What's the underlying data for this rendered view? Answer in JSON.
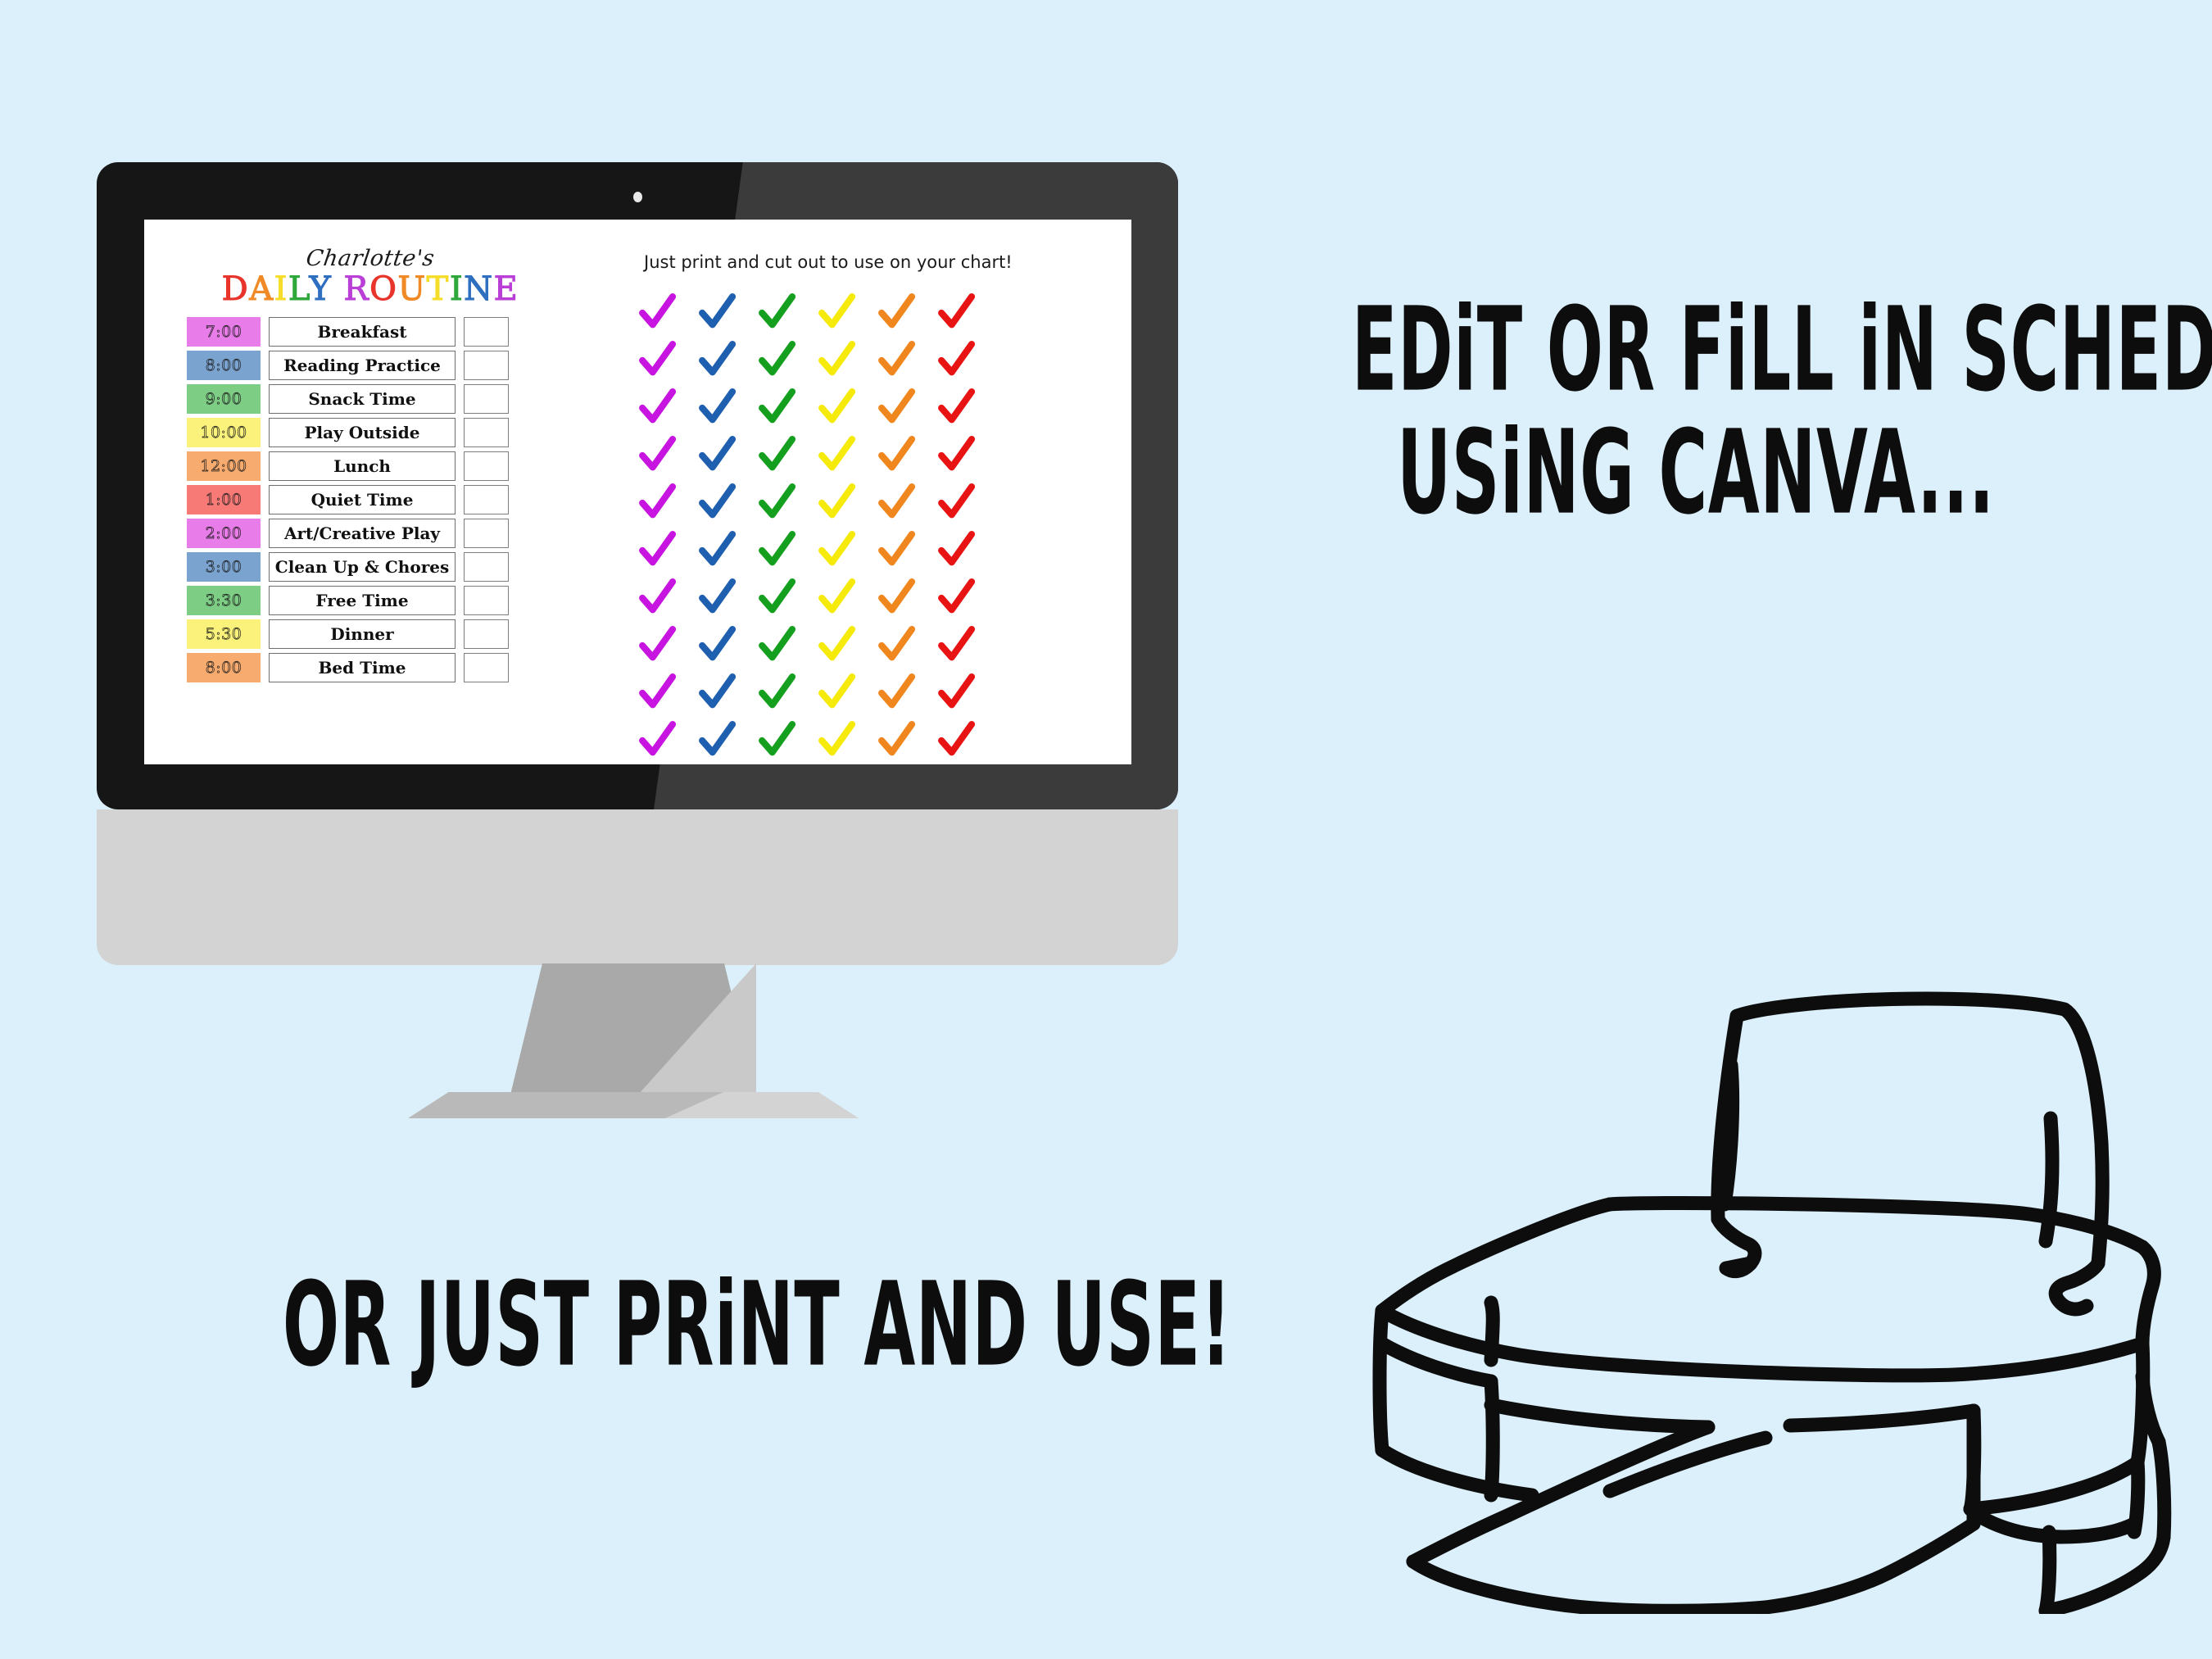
{
  "page": {
    "background_color": "#dcf0fb",
    "ink_color": "#0d0d0d"
  },
  "headline": {
    "line1": "EDiT OR FiLL iN SCHEDULE",
    "line2": "USiNG CANVA..."
  },
  "subline": {
    "text": "OR JUST PRiNT AND USE!"
  },
  "monitor": {
    "bezel_color": "#161616",
    "chin_color": "#d3d3d3",
    "stand_color": "#a9a9a9",
    "webcam": "webcam-dot"
  },
  "screen": {
    "owner_name": "Charlotte's",
    "title_letters": [
      {
        "char": "D",
        "color": "#e8342a"
      },
      {
        "char": "A",
        "color": "#f08a26"
      },
      {
        "char": "I",
        "color": "#f5dd2a"
      },
      {
        "char": "L",
        "color": "#2fa83b"
      },
      {
        "char": "Y",
        "color": "#2f6fc0"
      },
      {
        "char": " ",
        "color": "#000000"
      },
      {
        "char": "R",
        "color": "#b93fd6"
      },
      {
        "char": "O",
        "color": "#e8342a"
      },
      {
        "char": "U",
        "color": "#f08a26"
      },
      {
        "char": "T",
        "color": "#f5dd2a"
      },
      {
        "char": "I",
        "color": "#2fa83b"
      },
      {
        "char": "N",
        "color": "#2f6fc0"
      },
      {
        "char": "E",
        "color": "#b93fd6"
      }
    ],
    "title_text": "DAILY ROUTINE",
    "schedule": [
      {
        "time": "7:00",
        "activity": "Breakfast",
        "pill_color": "#e87ce8"
      },
      {
        "time": "8:00",
        "activity": "Reading Practice",
        "pill_color": "#7ba3d0"
      },
      {
        "time": "9:00",
        "activity": "Snack Time",
        "pill_color": "#7dcd85"
      },
      {
        "time": "10:00",
        "activity": "Play Outside",
        "pill_color": "#faf27a"
      },
      {
        "time": "12:00",
        "activity": "Lunch",
        "pill_color": "#f7ab6e"
      },
      {
        "time": "1:00",
        "activity": "Quiet Time",
        "pill_color": "#f77a77"
      },
      {
        "time": "2:00",
        "activity": "Art/Creative Play",
        "pill_color": "#e87ce8"
      },
      {
        "time": "3:00",
        "activity": "Clean Up & Chores",
        "pill_color": "#7ba3d0"
      },
      {
        "time": "3:30",
        "activity": "Free Time",
        "pill_color": "#7dcd85"
      },
      {
        "time": "5:30",
        "activity": "Dinner",
        "pill_color": "#faf27a"
      },
      {
        "time": "8:00",
        "activity": "Bed Time",
        "pill_color": "#f7ab6e"
      }
    ],
    "cut_note": "Just print and cut out to use on your chart!",
    "checkmarks": {
      "icon": "check-mark-icon",
      "columns": 6,
      "rows": 10,
      "column_colors": [
        "#c714e0",
        "#1f5fb0",
        "#14a01e",
        "#f5ea0a",
        "#f0861e",
        "#e81414"
      ]
    }
  },
  "printer": {
    "icon": "printer-illustration",
    "stroke_color": "#0d0d0d"
  }
}
